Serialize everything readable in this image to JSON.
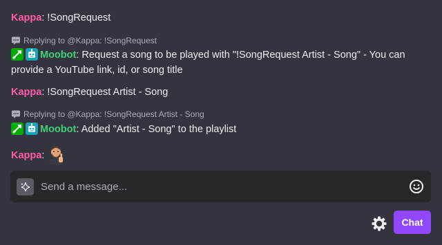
{
  "colors": {
    "background": "#33343d",
    "kappa_name": "#ff5ca8",
    "moobot_name": "#3ed178",
    "reply_text": "#adadb8",
    "input_bg": "#27272c",
    "chat_button": "#9147ff"
  },
  "messages": [
    {
      "user": "Kappa",
      "text": "!SongRequest"
    },
    {
      "reply_to": "Replying to @Kappa: !SongRequest",
      "badges": [
        "moderator-badge-icon",
        "bot-badge-icon"
      ],
      "user": "Moobot",
      "text_line1": "Request a song to be played with \"!SongRequest Artist - Song\" - You can",
      "text_line2": "provide a YouTube link, id, or song title"
    },
    {
      "user": "Kappa",
      "text": "!SongRequest Artist - Song"
    },
    {
      "reply_to": "Replying to @Kappa: !SongRequest Artist - Song",
      "badges": [
        "moderator-badge-icon",
        "bot-badge-icon"
      ],
      "user": "Moobot",
      "text": "Added \"Artist - Song\" to the playlist"
    },
    {
      "user": "Kappa",
      "emote": "thumbs-up-emote"
    }
  ],
  "input": {
    "placeholder": "Send a message...",
    "value": ""
  },
  "chat_button_label": "Chat"
}
